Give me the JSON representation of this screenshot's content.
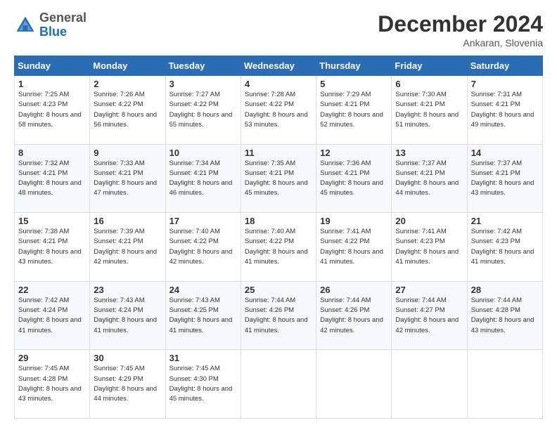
{
  "header": {
    "logo_general": "General",
    "logo_blue": "Blue",
    "month_title": "December 2024",
    "subtitle": "Ankaran, Slovenia"
  },
  "weekdays": [
    "Sunday",
    "Monday",
    "Tuesday",
    "Wednesday",
    "Thursday",
    "Friday",
    "Saturday"
  ],
  "weeks": [
    [
      {
        "day": "1",
        "sunrise": "Sunrise: 7:25 AM",
        "sunset": "Sunset: 4:23 PM",
        "daylight": "Daylight: 8 hours and 58 minutes."
      },
      {
        "day": "2",
        "sunrise": "Sunrise: 7:26 AM",
        "sunset": "Sunset: 4:22 PM",
        "daylight": "Daylight: 8 hours and 56 minutes."
      },
      {
        "day": "3",
        "sunrise": "Sunrise: 7:27 AM",
        "sunset": "Sunset: 4:22 PM",
        "daylight": "Daylight: 8 hours and 55 minutes."
      },
      {
        "day": "4",
        "sunrise": "Sunrise: 7:28 AM",
        "sunset": "Sunset: 4:22 PM",
        "daylight": "Daylight: 8 hours and 53 minutes."
      },
      {
        "day": "5",
        "sunrise": "Sunrise: 7:29 AM",
        "sunset": "Sunset: 4:21 PM",
        "daylight": "Daylight: 8 hours and 52 minutes."
      },
      {
        "day": "6",
        "sunrise": "Sunrise: 7:30 AM",
        "sunset": "Sunset: 4:21 PM",
        "daylight": "Daylight: 8 hours and 51 minutes."
      },
      {
        "day": "7",
        "sunrise": "Sunrise: 7:31 AM",
        "sunset": "Sunset: 4:21 PM",
        "daylight": "Daylight: 8 hours and 49 minutes."
      }
    ],
    [
      {
        "day": "8",
        "sunrise": "Sunrise: 7:32 AM",
        "sunset": "Sunset: 4:21 PM",
        "daylight": "Daylight: 8 hours and 48 minutes."
      },
      {
        "day": "9",
        "sunrise": "Sunrise: 7:33 AM",
        "sunset": "Sunset: 4:21 PM",
        "daylight": "Daylight: 8 hours and 47 minutes."
      },
      {
        "day": "10",
        "sunrise": "Sunrise: 7:34 AM",
        "sunset": "Sunset: 4:21 PM",
        "daylight": "Daylight: 8 hours and 46 minutes."
      },
      {
        "day": "11",
        "sunrise": "Sunrise: 7:35 AM",
        "sunset": "Sunset: 4:21 PM",
        "daylight": "Daylight: 8 hours and 45 minutes."
      },
      {
        "day": "12",
        "sunrise": "Sunrise: 7:36 AM",
        "sunset": "Sunset: 4:21 PM",
        "daylight": "Daylight: 8 hours and 45 minutes."
      },
      {
        "day": "13",
        "sunrise": "Sunrise: 7:37 AM",
        "sunset": "Sunset: 4:21 PM",
        "daylight": "Daylight: 8 hours and 44 minutes."
      },
      {
        "day": "14",
        "sunrise": "Sunrise: 7:37 AM",
        "sunset": "Sunset: 4:21 PM",
        "daylight": "Daylight: 8 hours and 43 minutes."
      }
    ],
    [
      {
        "day": "15",
        "sunrise": "Sunrise: 7:38 AM",
        "sunset": "Sunset: 4:21 PM",
        "daylight": "Daylight: 8 hours and 43 minutes."
      },
      {
        "day": "16",
        "sunrise": "Sunrise: 7:39 AM",
        "sunset": "Sunset: 4:21 PM",
        "daylight": "Daylight: 8 hours and 42 minutes."
      },
      {
        "day": "17",
        "sunrise": "Sunrise: 7:40 AM",
        "sunset": "Sunset: 4:22 PM",
        "daylight": "Daylight: 8 hours and 42 minutes."
      },
      {
        "day": "18",
        "sunrise": "Sunrise: 7:40 AM",
        "sunset": "Sunset: 4:22 PM",
        "daylight": "Daylight: 8 hours and 41 minutes."
      },
      {
        "day": "19",
        "sunrise": "Sunrise: 7:41 AM",
        "sunset": "Sunset: 4:22 PM",
        "daylight": "Daylight: 8 hours and 41 minutes."
      },
      {
        "day": "20",
        "sunrise": "Sunrise: 7:41 AM",
        "sunset": "Sunset: 4:23 PM",
        "daylight": "Daylight: 8 hours and 41 minutes."
      },
      {
        "day": "21",
        "sunrise": "Sunrise: 7:42 AM",
        "sunset": "Sunset: 4:23 PM",
        "daylight": "Daylight: 8 hours and 41 minutes."
      }
    ],
    [
      {
        "day": "22",
        "sunrise": "Sunrise: 7:42 AM",
        "sunset": "Sunset: 4:24 PM",
        "daylight": "Daylight: 8 hours and 41 minutes."
      },
      {
        "day": "23",
        "sunrise": "Sunrise: 7:43 AM",
        "sunset": "Sunset: 4:24 PM",
        "daylight": "Daylight: 8 hours and 41 minutes."
      },
      {
        "day": "24",
        "sunrise": "Sunrise: 7:43 AM",
        "sunset": "Sunset: 4:25 PM",
        "daylight": "Daylight: 8 hours and 41 minutes."
      },
      {
        "day": "25",
        "sunrise": "Sunrise: 7:44 AM",
        "sunset": "Sunset: 4:26 PM",
        "daylight": "Daylight: 8 hours and 41 minutes."
      },
      {
        "day": "26",
        "sunrise": "Sunrise: 7:44 AM",
        "sunset": "Sunset: 4:26 PM",
        "daylight": "Daylight: 8 hours and 42 minutes."
      },
      {
        "day": "27",
        "sunrise": "Sunrise: 7:44 AM",
        "sunset": "Sunset: 4:27 PM",
        "daylight": "Daylight: 8 hours and 42 minutes."
      },
      {
        "day": "28",
        "sunrise": "Sunrise: 7:44 AM",
        "sunset": "Sunset: 4:28 PM",
        "daylight": "Daylight: 8 hours and 43 minutes."
      }
    ],
    [
      {
        "day": "29",
        "sunrise": "Sunrise: 7:45 AM",
        "sunset": "Sunset: 4:28 PM",
        "daylight": "Daylight: 8 hours and 43 minutes."
      },
      {
        "day": "30",
        "sunrise": "Sunrise: 7:45 AM",
        "sunset": "Sunset: 4:29 PM",
        "daylight": "Daylight: 8 hours and 44 minutes."
      },
      {
        "day": "31",
        "sunrise": "Sunrise: 7:45 AM",
        "sunset": "Sunset: 4:30 PM",
        "daylight": "Daylight: 8 hours and 45 minutes."
      },
      null,
      null,
      null,
      null
    ]
  ]
}
